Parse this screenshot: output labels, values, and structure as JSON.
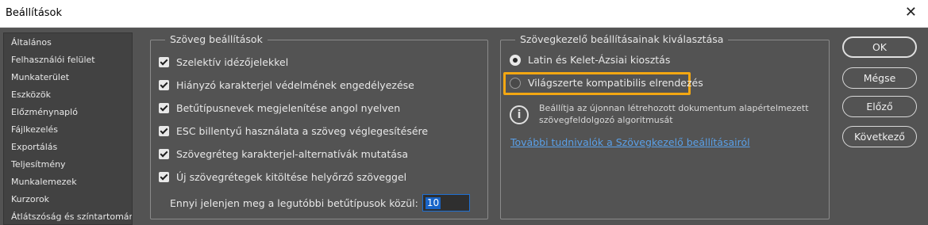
{
  "window": {
    "title": "Beállítások",
    "close_glyph": "✕"
  },
  "sidebar": {
    "items": [
      "Általános",
      "Felhasználói felület",
      "Munkaterület",
      "Eszközök",
      "Előzménynapló",
      "Fájlkezelés",
      "Exportálás",
      "Teljesítmény",
      "Munkalemezek",
      "Kurzorok",
      "Átlátszóság és színtartomány"
    ]
  },
  "text_settings": {
    "legend": "Szöveg beállítások",
    "checkboxes": [
      {
        "label": "Szelektív idézőjelekkel",
        "checked": true
      },
      {
        "label": "Hiányzó karakterjel védelmének engedélyezése",
        "checked": true
      },
      {
        "label": "Betűtípusnevek megjelenítése angol nyelven",
        "checked": true
      },
      {
        "label": "ESC billentyű használata a szöveg véglegesítésére",
        "checked": true
      },
      {
        "label": "Szövegréteg karakterjel-alternatívák mutatása",
        "checked": true
      },
      {
        "label": "Új szövegrétegek kitöltése helyőrző szöveggel",
        "checked": true
      }
    ],
    "recent_fonts_label": "Ennyi jelenjen meg a legutóbbi betűtípusok közül:",
    "recent_fonts_value": "10"
  },
  "engine": {
    "legend": "Szövegkezelő beállításainak kiválasztása",
    "options": [
      {
        "label": "Latin és Kelet-Ázsiai kiosztás",
        "selected": true
      },
      {
        "label": "Világszerte kompatibilis elrendezés",
        "selected": false
      }
    ],
    "info_text": "Beállítja az újonnan létrehozott dokumentum alapértelmezett szövegfeldolgozó algoritmusát",
    "link": "További tudnivalók a Szövegkezelő beállításairól",
    "highlight_color": "#f3a712"
  },
  "buttons": {
    "ok": "OK",
    "cancel": "Mégse",
    "prev": "Előző",
    "next": "Következő"
  },
  "colors": {
    "background": "#535353",
    "link": "#5aa0e8",
    "selection": "#1864c8"
  }
}
